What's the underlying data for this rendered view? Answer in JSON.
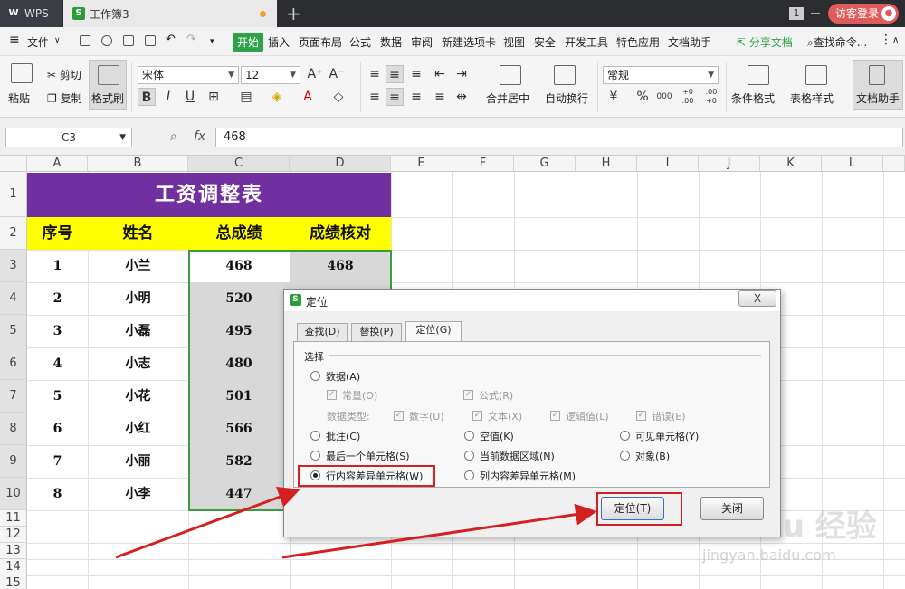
{
  "titlebar": {
    "wps_tab": "WPS",
    "workbook_tab": "工作簿3",
    "window_count": "1",
    "visitor_login": "访客登录"
  },
  "menu": {
    "file": "文件",
    "items": [
      "开始",
      "插入",
      "页面布局",
      "公式",
      "数据",
      "审阅",
      "新建选项卡",
      "视图",
      "安全",
      "开发工具",
      "特色应用",
      "文档助手"
    ],
    "share": "分享文档",
    "search": "查找命令..."
  },
  "ribbon": {
    "paste": "粘贴",
    "cut": "剪切",
    "copy": "复制",
    "format_painter": "格式刷",
    "font_name": "宋体",
    "font_size": "12",
    "merge_center": "合并居中",
    "wrap_text": "自动换行",
    "number_format": "常规",
    "cond_format": "条件格式",
    "table_style": "表格样式",
    "doc_helper": "文档助手",
    "bold": "B",
    "italic": "I",
    "underline": "U",
    "percent": "%",
    "thousands": "000",
    "dec_inc": "+0 .00",
    "dec_dec": ".00 +0"
  },
  "formula_bar": {
    "cell_ref": "C3",
    "fx": "fx",
    "value": "468"
  },
  "sheet": {
    "columns": [
      "A",
      "B",
      "C",
      "D",
      "E",
      "F",
      "G",
      "H",
      "I",
      "J",
      "K",
      "L"
    ],
    "rows": [
      "1",
      "2",
      "3",
      "4",
      "5",
      "6",
      "7",
      "8",
      "9",
      "10",
      "11",
      "12",
      "13",
      "14",
      "15"
    ],
    "title": "工资调整表",
    "headers": [
      "序号",
      "姓名",
      "总成绩",
      "成绩核对"
    ],
    "data": [
      [
        "1",
        "小兰",
        "468",
        "468"
      ],
      [
        "2",
        "小明",
        "520",
        ""
      ],
      [
        "3",
        "小磊",
        "495",
        ""
      ],
      [
        "4",
        "小志",
        "480",
        ""
      ],
      [
        "5",
        "小花",
        "501",
        ""
      ],
      [
        "6",
        "小红",
        "566",
        ""
      ],
      [
        "7",
        "小丽",
        "582",
        ""
      ],
      [
        "8",
        "小李",
        "447",
        ""
      ]
    ]
  },
  "dialog": {
    "title": "定位",
    "close": "X",
    "tabs": [
      "查找(D)",
      "替换(P)",
      "定位(G)"
    ],
    "group": "选择",
    "data_opt": "数据(A)",
    "const": "常量(O)",
    "formula": "公式(R)",
    "data_type": "数据类型:",
    "number": "数字(U)",
    "text": "文本(X)",
    "logical": "逻辑值(L)",
    "error": "错误(E)",
    "comments": "批注(C)",
    "blanks": "空值(K)",
    "visible": "可见单元格(Y)",
    "last_cell": "最后一个单元格(S)",
    "current_region": "当前数据区域(N)",
    "objects": "对象(B)",
    "row_diff": "行内容差异单元格(W)",
    "col_diff": "列内容差异单元格(M)",
    "locate_btn": "定位(T)",
    "close_btn": "关闭"
  },
  "watermark": {
    "brand": "Bai du 经验",
    "url": "jingyan.baidu.com"
  },
  "colors": {
    "title_bg": "#7030a0",
    "header_bg": "#ffff00",
    "highlight": "#d42020",
    "selection": "#3c9b3c"
  }
}
